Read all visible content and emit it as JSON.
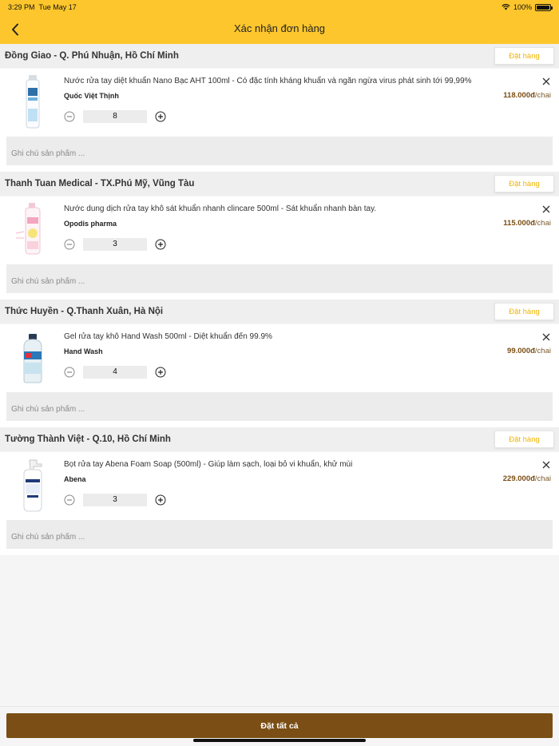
{
  "status": {
    "time": "3:29 PM",
    "date": "Tue May 17",
    "battery": "100%"
  },
  "header": {
    "title": "Xác nhận đơn hàng"
  },
  "common": {
    "order_label": "Đặt hàng",
    "note_placeholder": "Ghi chú sản phẩm ..."
  },
  "sections": [
    {
      "store": "Đồng Giao - Q. Phú Nhuận, Hồ Chí Minh",
      "product": {
        "name": "Nước rửa tay diệt khuẩn Nano Bạc AHT 100ml - Có đặc tính kháng khuẩn và ngăn ngừa virus phát sinh tới 99,99%",
        "brand": "Quốc Việt Thịnh",
        "price": "118.000đ",
        "unit": "/chai",
        "quantity": "8",
        "image": "nano-bac-bottle"
      }
    },
    {
      "store": "Thanh Tuan Medical - TX.Phú Mỹ, Vũng Tàu",
      "product": {
        "name": "Nước dung dịch rửa tay khô sát khuẩn nhanh clincare 500ml -  Sát khuẩn nhanh bàn tay.",
        "brand": "Opodis pharma",
        "price": "115.000đ",
        "unit": "/chai",
        "quantity": "3",
        "image": "clincare-bottle"
      }
    },
    {
      "store": "Thức Huyền - Q.Thanh Xuân, Hà Nội",
      "product": {
        "name": "Gel rửa tay khô Hand Wash 500ml - Diệt khuẩn đến 99.9%",
        "brand": "Hand Wash",
        "price": "99.000đ",
        "unit": "/chai",
        "quantity": "4",
        "image": "hand-wash-bottle"
      }
    },
    {
      "store": "Tường Thành Việt - Q.10, Hồ Chí Minh",
      "product": {
        "name": "Bọt rửa tay Abena Foam Soap (500ml) - Giúp làm sạch, loại bỏ vi khuẩn, khử mùi",
        "brand": "Abena",
        "price": "229.000đ",
        "unit": "/chai",
        "quantity": "3",
        "image": "abena-foam-bottle"
      }
    }
  ],
  "footer": {
    "order_all_label": "Đặt tất cả"
  },
  "colors": {
    "header_bg": "#fcc62c",
    "accent": "#f0b400",
    "primary_button": "#7a4e14",
    "price": "#7a4e14"
  }
}
